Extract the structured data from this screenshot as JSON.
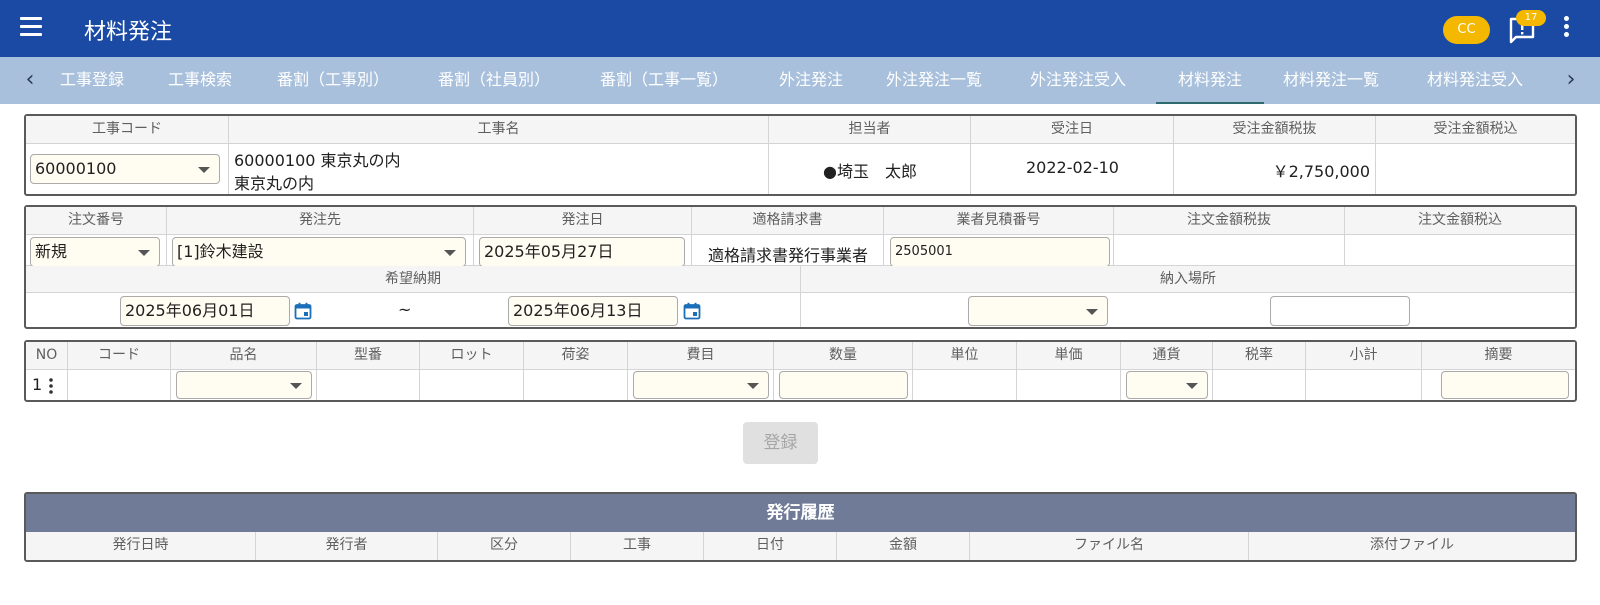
{
  "header": {
    "title": "材料発注",
    "user_badge": "CC",
    "notification_count": "17",
    "colors": {
      "appbar": "#1a4aa3",
      "tabbar": "#a8c0dc",
      "badge": "#f5b800"
    }
  },
  "tabs": [
    {
      "label": "工事登録"
    },
    {
      "label": "工事検索"
    },
    {
      "label": "番割（工事別）"
    },
    {
      "label": "番割（社員別）"
    },
    {
      "label": "番割（工事一覧）"
    },
    {
      "label": "外注発注"
    },
    {
      "label": "外注発注一覧"
    },
    {
      "label": "外注発注受入"
    },
    {
      "label": "材料発注",
      "active": true
    },
    {
      "label": "材料発注一覧"
    },
    {
      "label": "材料発注受入"
    }
  ],
  "project": {
    "headers": [
      "工事コード",
      "工事名",
      "担当者",
      "受注日",
      "受注金額税抜",
      "受注金額税込"
    ],
    "code": "60000100",
    "name_line1": "60000100 東京丸の内",
    "name_line2": "東京丸の内",
    "person": "●埼玉　太郎",
    "order_date": "2022-02-10",
    "amount_excl": "￥2,750,000",
    "amount_incl": ""
  },
  "order": {
    "headers": [
      "注文番号",
      "発注先",
      "発注日",
      "適格請求書",
      "業者見積番号",
      "注文金額税抜",
      "注文金額税込"
    ],
    "order_no": "新規",
    "supplier": "[1]鈴木建設",
    "order_date": "2025年05月27日",
    "invoice": "適格請求書発行事業者",
    "quote_no": "2505001",
    "delivery_header": "希望納期",
    "place_header": "納入場所",
    "delivery_from": "2025年06月01日",
    "delivery_sep": "~",
    "delivery_to": "2025年06月13日"
  },
  "items": {
    "headers": [
      "NO",
      "コード",
      "品名",
      "型番",
      "ロット",
      "荷姿",
      "費目",
      "数量",
      "単位",
      "単価",
      "通貨",
      "税率",
      "小計",
      "摘要"
    ],
    "rows": [
      {
        "no": "1"
      }
    ]
  },
  "register_label": "登録",
  "history": {
    "title": "発行履歴",
    "headers": [
      "発行日時",
      "発行者",
      "区分",
      "工事",
      "日付",
      "金額",
      "ファイル名",
      "添付ファイル"
    ]
  }
}
